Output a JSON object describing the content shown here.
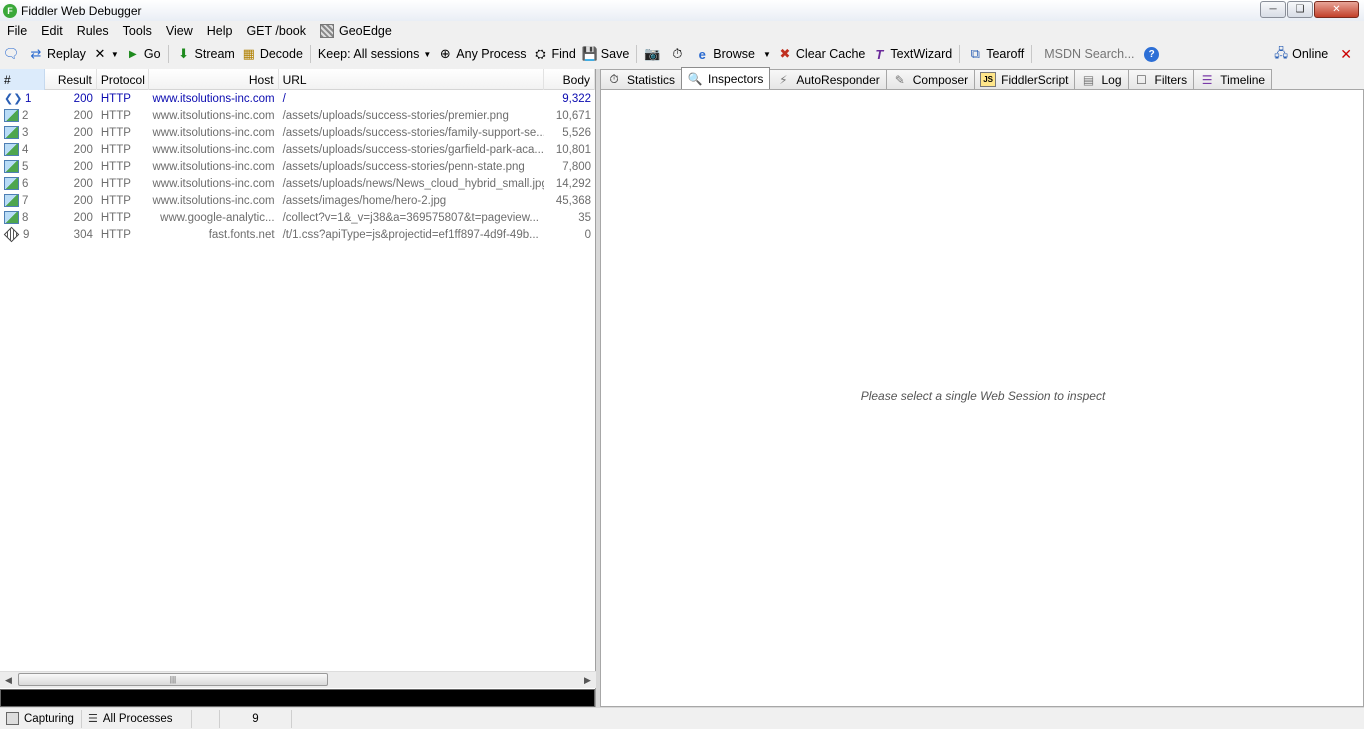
{
  "window": {
    "title": "Fiddler Web Debugger",
    "app_icon_letter": "F"
  },
  "menu": [
    "File",
    "Edit",
    "Rules",
    "Tools",
    "View",
    "Help",
    "GET /book",
    "GeoEdge"
  ],
  "toolbar": {
    "replay": "Replay",
    "go": "Go",
    "stream": "Stream",
    "decode": "Decode",
    "keep": "Keep: All sessions",
    "any_process": "Any Process",
    "find": "Find",
    "save": "Save",
    "browse": "Browse",
    "clear_cache": "Clear Cache",
    "textwizard": "TextWizard",
    "tearoff": "Tearoff",
    "msdn_placeholder": "MSDN Search...",
    "online": "Online"
  },
  "sessions": {
    "columns": {
      "num": "#",
      "result": "Result",
      "protocol": "Protocol",
      "host": "Host",
      "url": "URL",
      "body": "Body"
    },
    "rows": [
      {
        "num": "1",
        "result": "200",
        "protocol": "HTTP",
        "host": "www.itsolutions-inc.com",
        "url": "/",
        "body": "9,322",
        "icon": "html-icon"
      },
      {
        "num": "2",
        "result": "200",
        "protocol": "HTTP",
        "host": "www.itsolutions-inc.com",
        "url": "/assets/uploads/success-stories/premier.png",
        "body": "10,671",
        "icon": "image-icon"
      },
      {
        "num": "3",
        "result": "200",
        "protocol": "HTTP",
        "host": "www.itsolutions-inc.com",
        "url": "/assets/uploads/success-stories/family-support-se...",
        "body": "5,526",
        "icon": "image-icon"
      },
      {
        "num": "4",
        "result": "200",
        "protocol": "HTTP",
        "host": "www.itsolutions-inc.com",
        "url": "/assets/uploads/success-stories/garfield-park-aca...",
        "body": "10,801",
        "icon": "image-icon"
      },
      {
        "num": "5",
        "result": "200",
        "protocol": "HTTP",
        "host": "www.itsolutions-inc.com",
        "url": "/assets/uploads/success-stories/penn-state.png",
        "body": "7,800",
        "icon": "image-icon"
      },
      {
        "num": "6",
        "result": "200",
        "protocol": "HTTP",
        "host": "www.itsolutions-inc.com",
        "url": "/assets/uploads/news/News_cloud_hybrid_small.jpg",
        "body": "14,292",
        "icon": "image-icon"
      },
      {
        "num": "7",
        "result": "200",
        "protocol": "HTTP",
        "host": "www.itsolutions-inc.com",
        "url": "/assets/images/home/hero-2.jpg",
        "body": "45,368",
        "icon": "image-icon"
      },
      {
        "num": "8",
        "result": "200",
        "protocol": "HTTP",
        "host": "www.google-analytic...",
        "url": "/collect?v=1&_v=j38&a=369575807&t=pageview...",
        "body": "35",
        "icon": "image-icon"
      },
      {
        "num": "9",
        "result": "304",
        "protocol": "HTTP",
        "host": "fast.fonts.net",
        "url": "/t/1.css?apiType=js&projectid=ef1ff897-4d9f-49b...",
        "body": "0",
        "icon": "css-icon"
      }
    ]
  },
  "tabs": [
    "Statistics",
    "Inspectors",
    "AutoResponder",
    "Composer",
    "FiddlerScript",
    "Log",
    "Filters",
    "Timeline"
  ],
  "active_tab": "Inspectors",
  "inspector_message": "Please select a single Web Session to inspect",
  "status": {
    "capturing": "Capturing",
    "processes": "All Processes",
    "count": "9"
  },
  "colors": {
    "first_row": "#0a0ab0",
    "other_rows": "#6d6d6d",
    "quickexec": "#000000"
  }
}
